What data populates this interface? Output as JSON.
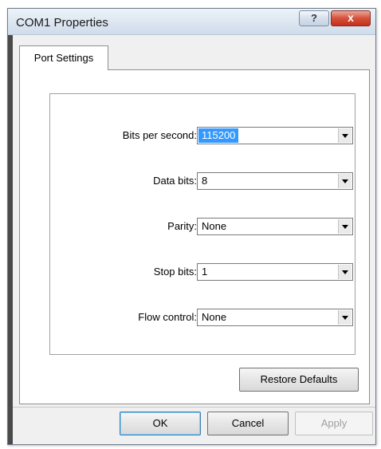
{
  "window": {
    "title": "COM1 Properties",
    "help_label": "?",
    "close_label": "x"
  },
  "tabs": [
    {
      "label": "Port Settings",
      "active": true
    }
  ],
  "fields": [
    {
      "label": "Bits per second:",
      "value": "115200",
      "selected": true
    },
    {
      "label": "Data bits:",
      "value": "8"
    },
    {
      "label": "Parity:",
      "value": "None"
    },
    {
      "label": "Stop bits:",
      "value": "1"
    },
    {
      "label": "Flow control:",
      "value": "None"
    }
  ],
  "buttons": {
    "restore_defaults": "Restore Defaults",
    "ok": "OK",
    "cancel": "Cancel",
    "apply": "Apply"
  },
  "colors": {
    "selection": "#3399ff",
    "close_button": "#d6503a"
  }
}
